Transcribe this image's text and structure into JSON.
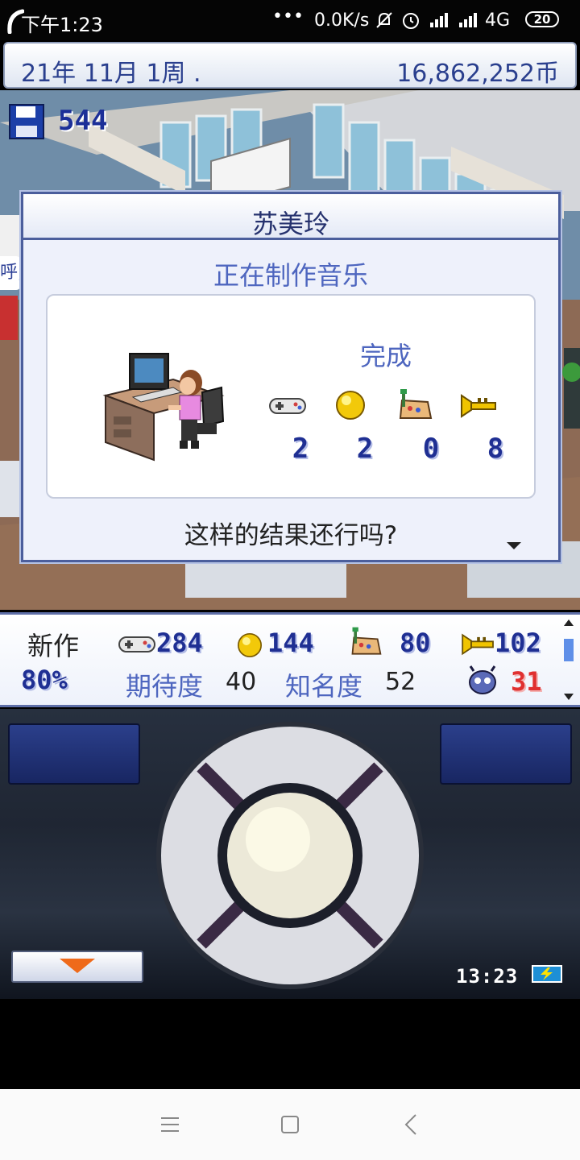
{
  "status_bar": {
    "time": "下午1:23",
    "dots": "•••",
    "net_speed": "0.0K/s",
    "network": "4G",
    "battery": "20"
  },
  "top_bar": {
    "date": "21年 11月 1周 .",
    "money": "16,862,252币"
  },
  "scene": {
    "save_count": "544",
    "left_edge_text": "呼,"
  },
  "dialog": {
    "staff_name": "苏美玲",
    "task": "正在制作音乐",
    "done_label": "完成",
    "stats": [
      {
        "icon": "gamepad-icon",
        "value": "2"
      },
      {
        "icon": "gold-orb-icon",
        "value": "2"
      },
      {
        "icon": "paint-palette-icon",
        "value": "0"
      },
      {
        "icon": "trumpet-icon",
        "value": "8"
      }
    ],
    "question": "这样的结果还行吗?"
  },
  "info_panel": {
    "label_new": "新作",
    "progress": "80%",
    "fun": "284",
    "creativity": "144",
    "graphics": "80",
    "sound": "102",
    "expectation_label": "期待度",
    "expectation_value": "40",
    "fame_label": "知名度",
    "fame_value": "52",
    "bugs": "31"
  },
  "controller": {
    "clock": "13:23"
  },
  "colors": {
    "accent_blue": "#4e66bf",
    "pixel_number_blue": "#1f2f93",
    "bug_red": "#e03030"
  }
}
